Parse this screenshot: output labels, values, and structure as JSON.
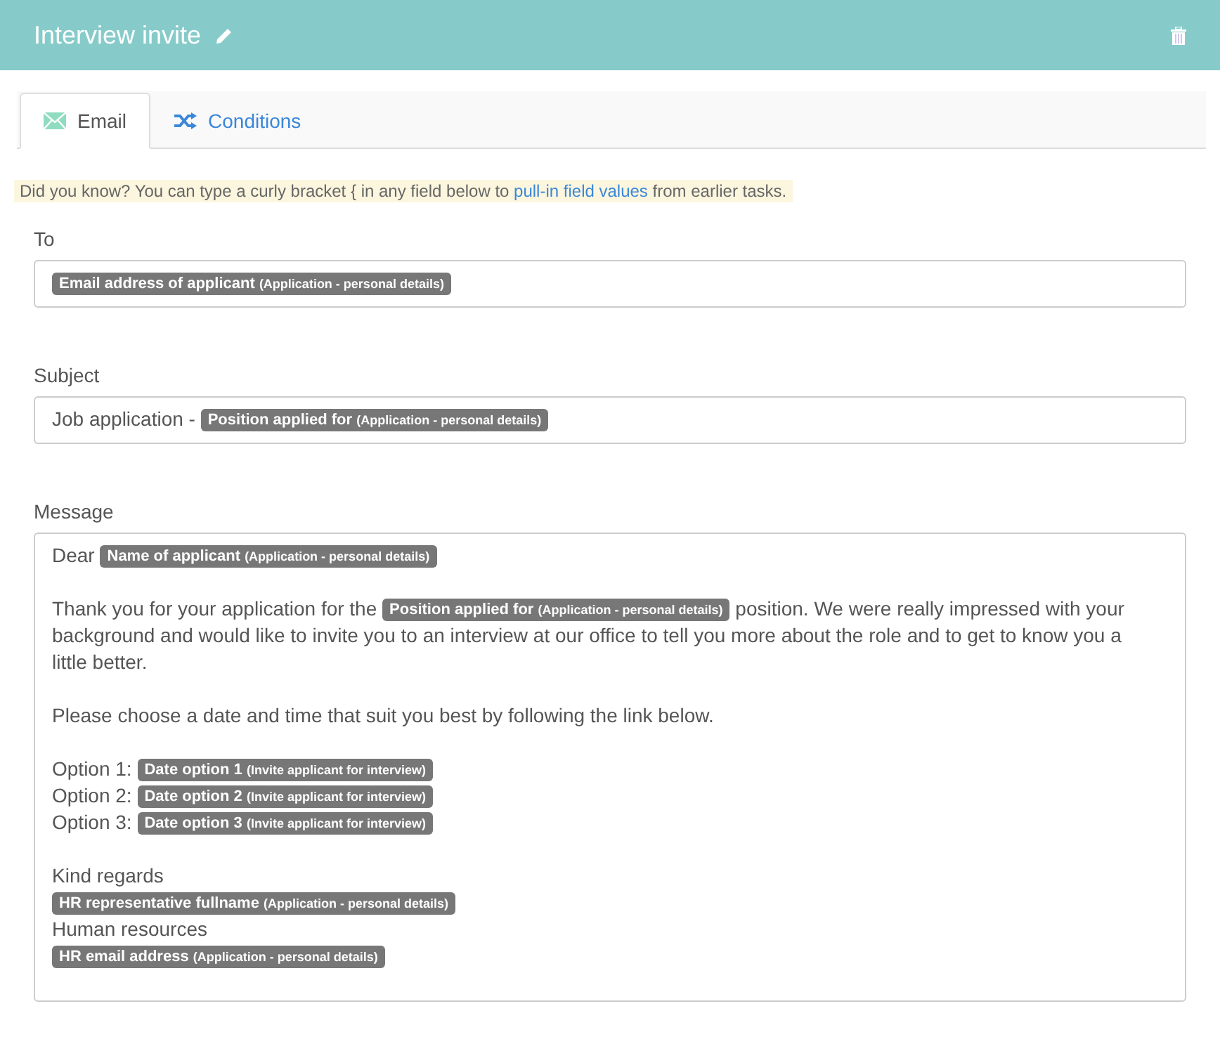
{
  "header": {
    "title": "Interview invite"
  },
  "tabs": [
    {
      "label": "Email",
      "selected": true
    },
    {
      "label": "Conditions",
      "selected": false
    }
  ],
  "tip": {
    "before": "Did you know? You can type a curly bracket { in any field below to",
    "link": "pull-in field values",
    "after": "from earlier tasks."
  },
  "fields": [
    {
      "label": "To",
      "kind": "input",
      "paragraphs": [
        [
          [
            {
              "kind": "chip",
              "field": "Email address of applicant",
              "source": "(Application - personal details)"
            }
          ]
        ]
      ]
    },
    {
      "label": "Subject",
      "kind": "input",
      "paragraphs": [
        [
          [
            {
              "kind": "text",
              "text": "Job application -"
            },
            {
              "kind": "chip",
              "field": "Position applied for",
              "source": "(Application - personal details)"
            }
          ]
        ]
      ]
    },
    {
      "label": "Message",
      "kind": "textarea",
      "paragraphs": [
        [
          [
            {
              "kind": "text",
              "text": "Dear"
            },
            {
              "kind": "chip",
              "field": "Name of applicant",
              "source": "(Application - personal details)"
            }
          ]
        ],
        [
          [
            {
              "kind": "text",
              "text": "Thank you for your application for the"
            },
            {
              "kind": "chip",
              "field": "Position applied for",
              "source": "(Application - personal details)"
            },
            {
              "kind": "text",
              "text": "position. We were really impressed with your background and would like to invite you to an interview at our office to tell you more about the role and to get to know you a little better."
            }
          ]
        ],
        [
          [
            {
              "kind": "text",
              "text": "Please choose a date and time that suit you best by following the link below."
            }
          ]
        ],
        [
          [
            {
              "kind": "text",
              "text": "Option 1:"
            },
            {
              "kind": "chip",
              "field": "Date option 1",
              "source": "(Invite applicant for interview)"
            }
          ],
          [
            {
              "kind": "text",
              "text": "Option 2:"
            },
            {
              "kind": "chip",
              "field": "Date option 2",
              "source": "(Invite applicant for interview)"
            }
          ],
          [
            {
              "kind": "text",
              "text": "Option 3:"
            },
            {
              "kind": "chip",
              "field": "Date option 3",
              "source": "(Invite applicant for interview)"
            }
          ]
        ],
        [
          [
            {
              "kind": "text",
              "text": "Kind regards"
            }
          ],
          [
            {
              "kind": "chip",
              "field": "HR representative fullname",
              "source": "(Application - personal details)"
            }
          ],
          [
            {
              "kind": "text",
              "text": "Human resources"
            }
          ],
          [
            {
              "kind": "chip",
              "field": "HR email address",
              "source": "(Application - personal details)"
            }
          ]
        ]
      ]
    }
  ]
}
